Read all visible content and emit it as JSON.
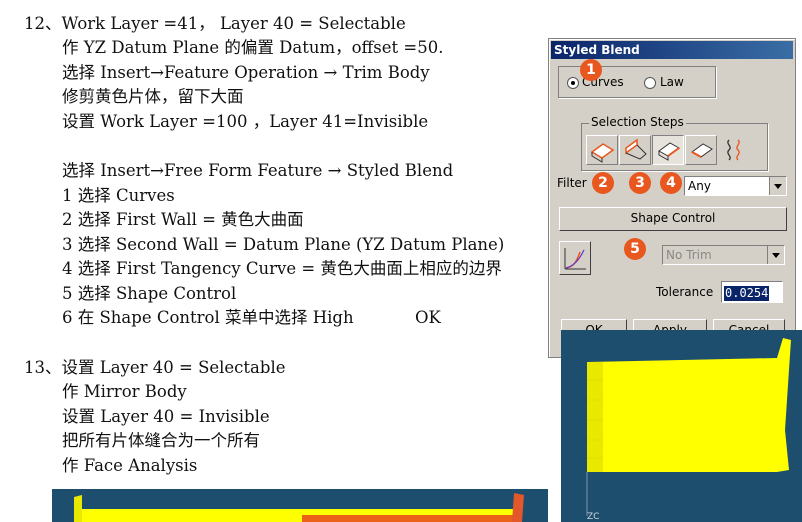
{
  "doc": {
    "lines": [
      {
        "key": "h12",
        "text": "12、Work Layer =41，    Layer 40 = Selectable"
      },
      {
        "key": "l1",
        "text": "作 YZ Datum Plane 的偏置 Datum，offset =50."
      },
      {
        "key": "l2",
        "text": "选择  Insert→Feature Operation → Trim Body"
      },
      {
        "key": "l3",
        "text": "修剪黄色片体，留下大面"
      },
      {
        "key": "l4",
        "text": "设置  Work Layer =100   ，Layer 41=Invisible"
      },
      {
        "key": "l5",
        "text": "选择  Insert→Free Form Feature → Styled Blend"
      },
      {
        "key": "l6",
        "text": "1 选择  Curves"
      },
      {
        "key": "l7",
        "text": "2 选择 First Wall =  黄色大曲面"
      },
      {
        "key": "l8",
        "text": "3 选择 Second Wall = Datum Plane (YZ Datum Plane)"
      },
      {
        "key": "l9",
        "text": "4 选择 First Tangency Curve =  黄色大曲面上相应的边界"
      },
      {
        "key": "l10",
        "text": "5 选择 Shape Control"
      },
      {
        "key": "l11",
        "text": "6 在 Shape Control 菜单中选择 High"
      },
      {
        "key": "ok",
        "text": "OK"
      },
      {
        "key": "h13",
        "text": "13、设置  Layer 40 = Selectable"
      },
      {
        "key": "l12",
        "text": "作  Mirror Body"
      },
      {
        "key": "l13",
        "text": "设置  Layer 40 = Invisible"
      },
      {
        "key": "l14",
        "text": "把所有片体缝合为一个所有"
      },
      {
        "key": "l15",
        "text": "作  Face Analysis"
      }
    ]
  },
  "dialog": {
    "title": "Styled Blend",
    "radio_curves": "Curves",
    "radio_law": "Law",
    "selection_steps_label": "Selection Steps",
    "filter_label": "Filter",
    "filter_value": "Any",
    "shape_control_button": "Shape Control",
    "trim_value": "No Trim",
    "tolerance_label": "Tolerance",
    "tolerance_value": "0.0254",
    "ok_button": "OK",
    "apply_button": "Apply",
    "cancel_button": "Cancel",
    "badges": [
      "1",
      "2",
      "3",
      "4",
      "5"
    ]
  },
  "viewport": {
    "axis_label": "ZC"
  },
  "colors": {
    "badge": "#e8571e",
    "surface": "#ffff00",
    "viewport_bg": "#1d4e6e",
    "title_bar": "#0a246a"
  }
}
